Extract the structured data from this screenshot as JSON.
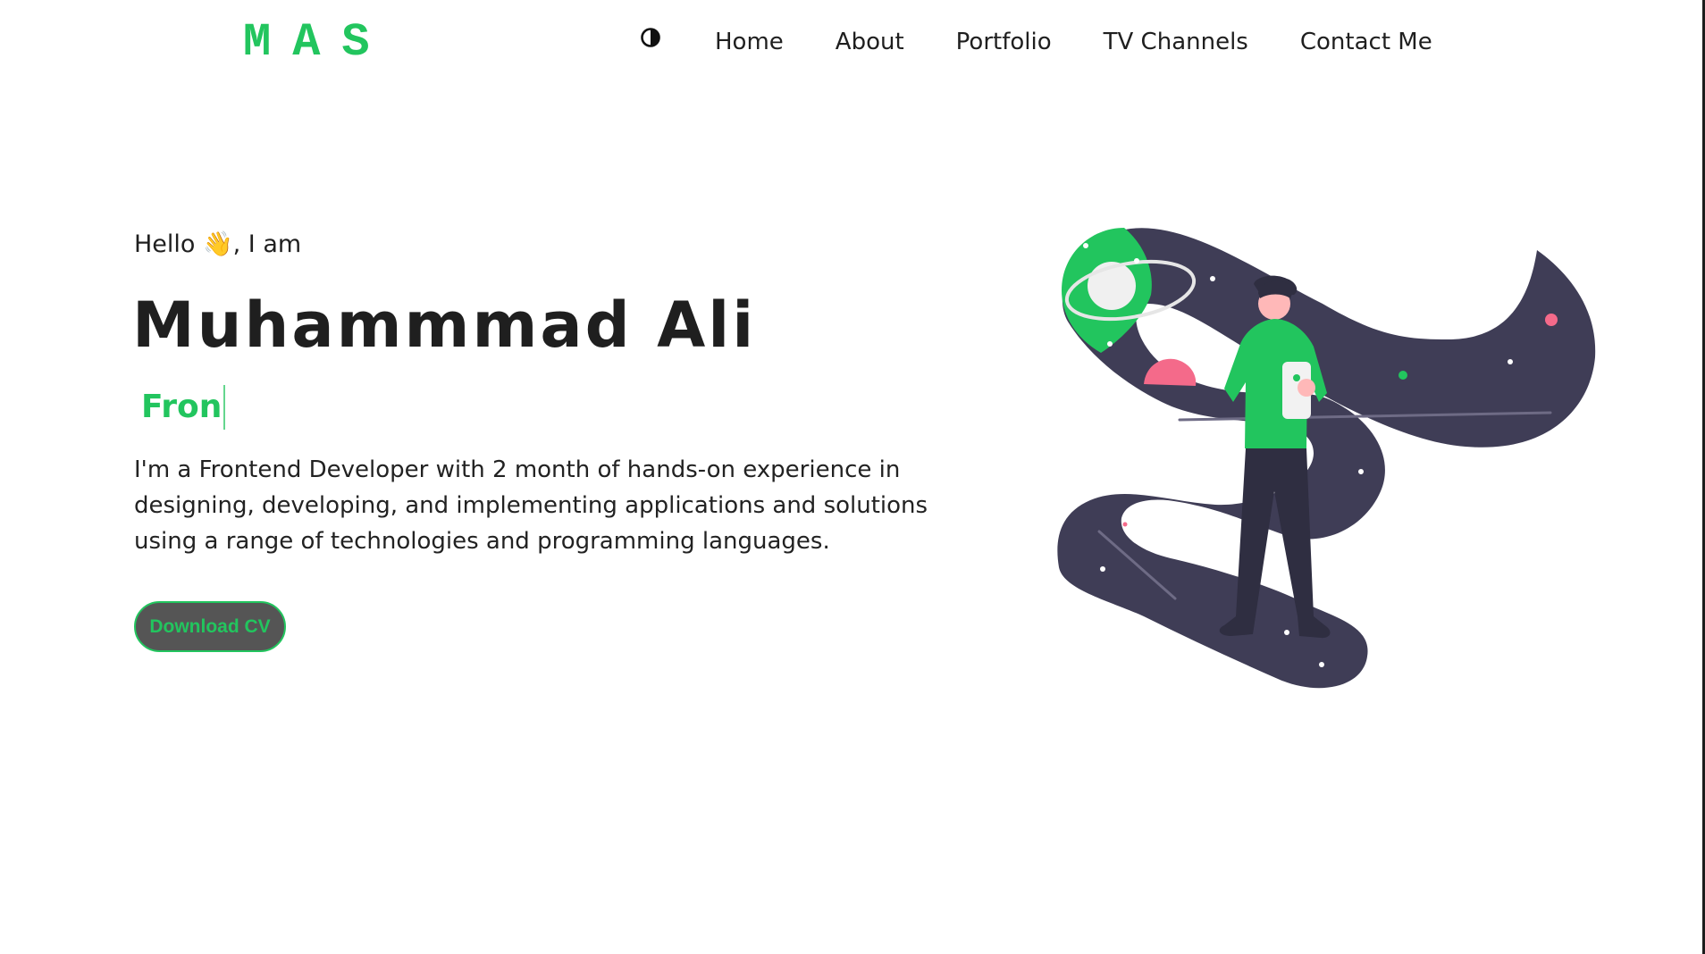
{
  "header": {
    "logo": "MAS",
    "theme_toggle_icon": "half-circle-contrast-icon",
    "nav": [
      {
        "label": "Home"
      },
      {
        "label": "About"
      },
      {
        "label": "Portfolio"
      },
      {
        "label": "TV Channels"
      },
      {
        "label": "Contact Me"
      }
    ]
  },
  "hero": {
    "greeting": "Hello 👋, I am",
    "name": "Muhammmad Ali",
    "typed_text": "Fron",
    "bio": "I'm a Frontend Developer with 2 month of hands-on experience in designing, developing, and implementing applications and solutions using a range of technologies and programming languages.",
    "cta_label": "Download CV"
  },
  "colors": {
    "accent": "#22c55e",
    "text": "#1f1f1f",
    "button_bg": "#555555",
    "illustration_dark": "#3f3d56",
    "illustration_pink": "#f46a8a"
  }
}
